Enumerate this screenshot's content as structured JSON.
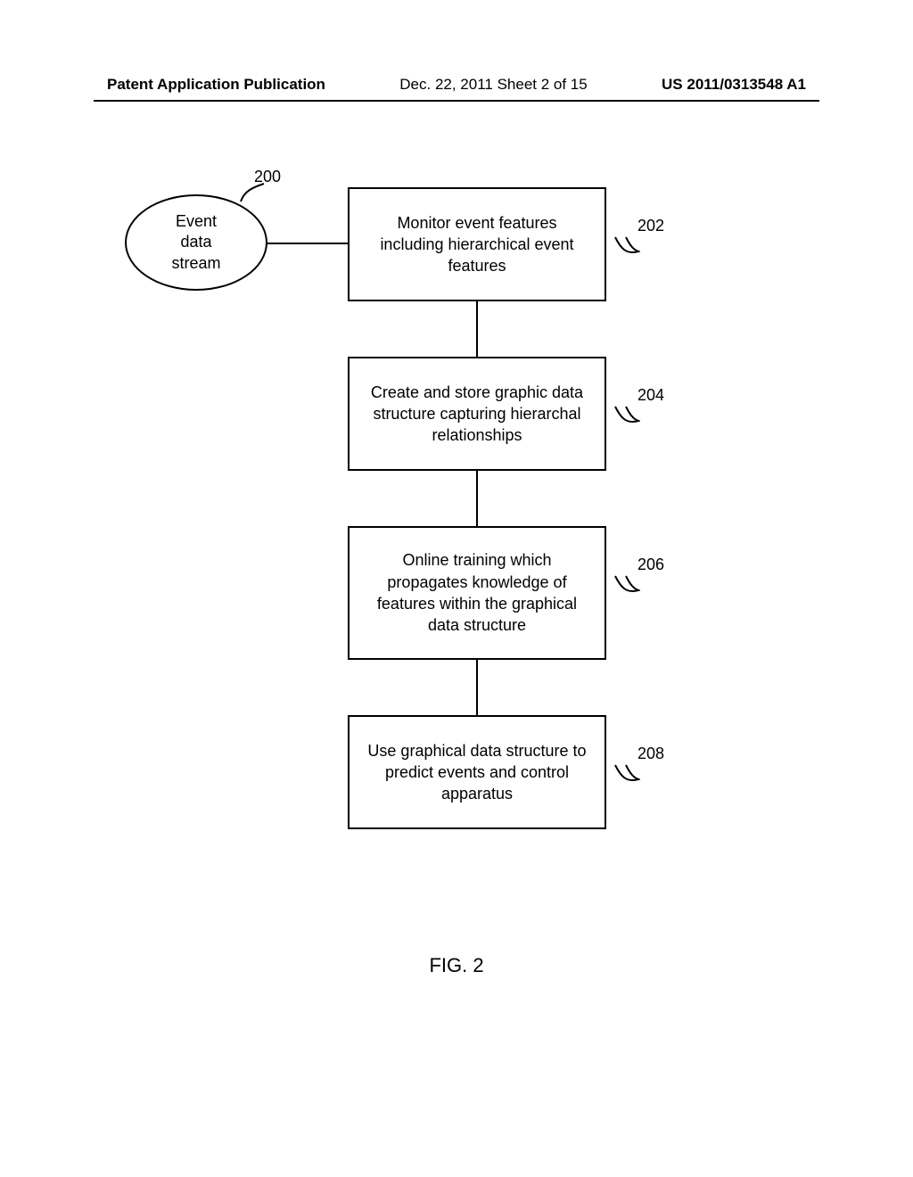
{
  "header": {
    "left": "Patent Application Publication",
    "center": "Dec. 22, 2011   Sheet 2 of 15",
    "right": "US 2011/0313548 A1"
  },
  "diagram": {
    "ellipse": {
      "text": "Event\ndata\nstream",
      "ref": "200"
    },
    "boxes": {
      "b202": {
        "text": "Monitor event features including hierarchical event features",
        "ref": "202"
      },
      "b204": {
        "text": "Create and store graphic data structure capturing hierarchal relationships",
        "ref": "204"
      },
      "b206": {
        "text": "Online training which propagates knowledge of features within the graphical data structure",
        "ref": "206"
      },
      "b208": {
        "text": "Use graphical data structure to predict events and control apparatus",
        "ref": "208"
      }
    }
  },
  "figure_label": "FIG. 2"
}
